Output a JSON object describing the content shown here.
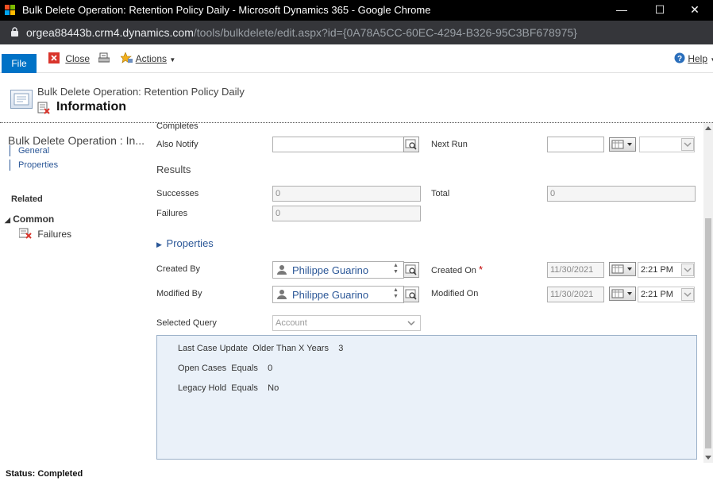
{
  "window": {
    "title": "Bulk Delete Operation: Retention Policy Daily - Microsoft Dynamics 365 - Google Chrome",
    "minimize": "—",
    "maximize": "☐",
    "close": "✕"
  },
  "address": {
    "host": "orgea88443b.crm4.dynamics.com",
    "path": "/tools/bulkdelete/edit.aspx?id={0A78A5CC-60EC-4294-B326-95C3BF678975}"
  },
  "commandbar": {
    "file_label": "File",
    "close_label": "Close",
    "actions_label": "Actions",
    "help_label": "Help"
  },
  "header": {
    "entity_name": "Bulk Delete Operation: Retention Policy Daily",
    "form_name": "Information"
  },
  "nav": {
    "entity_title": "Bulk Delete Operation : In...",
    "links": [
      "General",
      "Properties"
    ],
    "related_label": "Related",
    "common_label": "Common",
    "common_items": [
      "Failures"
    ]
  },
  "form": {
    "completes_label": "Completes",
    "also_notify_label": "Also Notify",
    "also_notify_value": "",
    "next_run_label": "Next Run",
    "next_run_date": "",
    "next_run_time": "",
    "results_section": "Results",
    "successes_label": "Successes",
    "successes_value": "0",
    "total_label": "Total",
    "total_value": "0",
    "failures_label": "Failures",
    "failures_value": "0",
    "properties_section": "Properties",
    "created_by_label": "Created By",
    "created_by_value": "Philippe Guarino",
    "created_on_label": "Created On",
    "required_marker": "*",
    "created_on_date": "11/30/2021",
    "created_on_time": "2:21 PM",
    "modified_by_label": "Modified By",
    "modified_by_value": "Philippe Guarino",
    "modified_on_label": "Modified On",
    "modified_on_date": "11/30/2021",
    "modified_on_time": "2:21 PM",
    "selected_query_label": "Selected Query",
    "selected_query_value": "Account",
    "query_conditions": [
      "Last Case Update  Older Than X Years    3",
      "Open Cases  Equals    0",
      "Legacy Hold  Equals    No"
    ]
  },
  "status": {
    "text": "Status: Completed"
  },
  "colors": {
    "accent": "#0072c6",
    "link": "#2b5797",
    "query_bg": "#eaf1f9",
    "required": "#c00000"
  }
}
